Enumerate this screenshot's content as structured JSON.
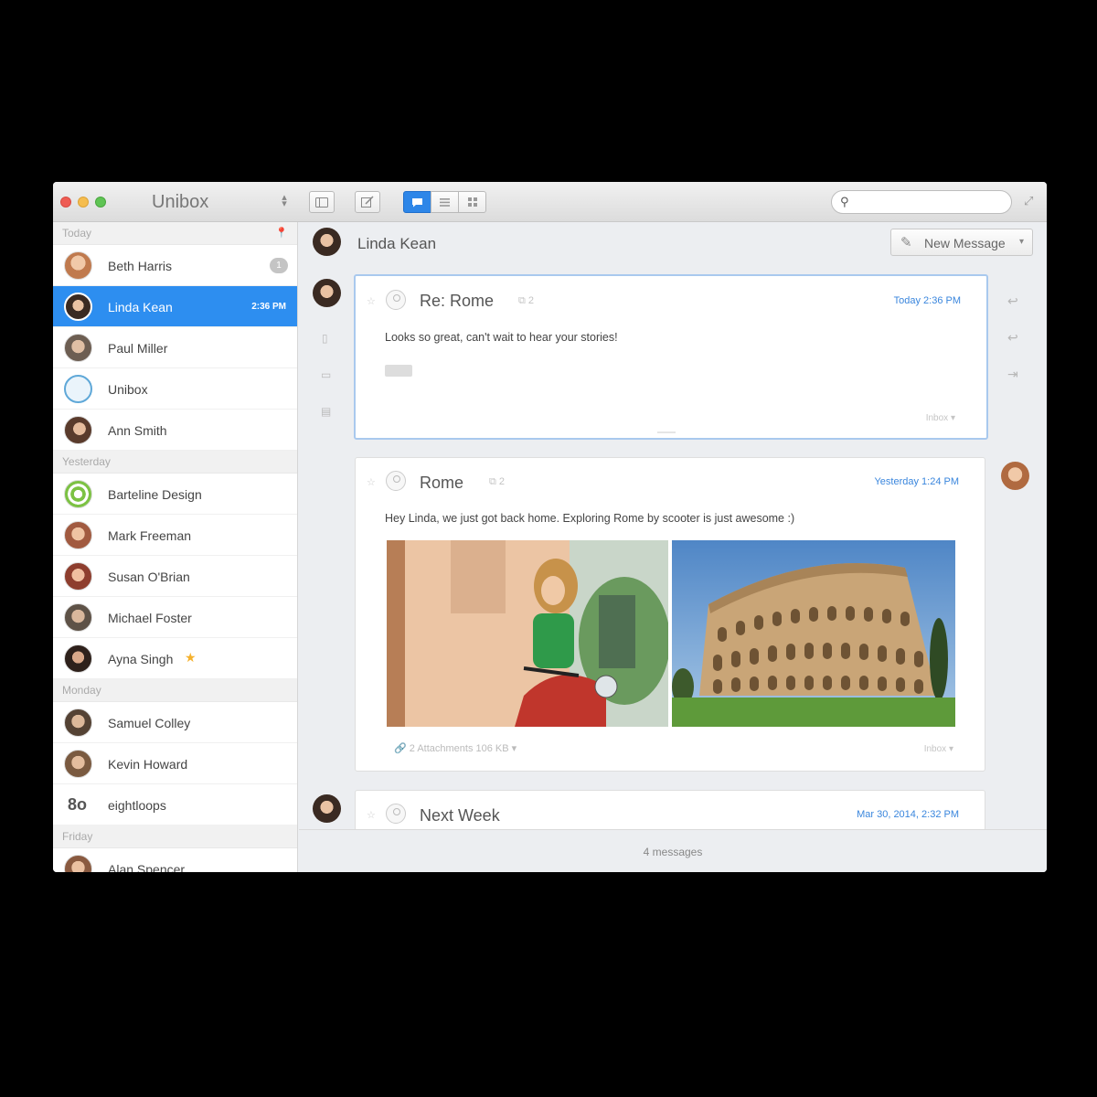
{
  "window": {
    "title": "Unibox"
  },
  "search": {
    "placeholder": "",
    "value": ""
  },
  "sidebar": {
    "sections": [
      {
        "label": "Today",
        "contacts": [
          {
            "name": "Beth Harris",
            "badge": "1",
            "avatar_color": "#c98a6c"
          },
          {
            "name": "Linda Kean",
            "time": "2:36 PM",
            "selected": true,
            "avatar_color": "#4a3a30"
          },
          {
            "name": "Paul Miller",
            "avatar_color": "#8a7a6a"
          },
          {
            "name": "Unibox",
            "avatar_color": "#5fa8d8"
          },
          {
            "name": "Ann Smith",
            "avatar_color": "#6b4a3a"
          }
        ]
      },
      {
        "label": "Yesterday",
        "contacts": [
          {
            "name": "Barteline Design",
            "avatar_color": "#7cc243"
          },
          {
            "name": "Mark Freeman",
            "avatar_color": "#b46a52"
          },
          {
            "name": "Susan O'Brian",
            "avatar_color": "#9a4a3a"
          },
          {
            "name": "Michael Foster",
            "avatar_color": "#7a6a5a"
          },
          {
            "name": "Ayna Singh",
            "starred": true,
            "avatar_color": "#3a2a22"
          }
        ]
      },
      {
        "label": "Monday",
        "contacts": [
          {
            "name": "Samuel Colley",
            "avatar_color": "#6a5848"
          },
          {
            "name": "Kevin Howard",
            "avatar_color": "#8c6a4e"
          },
          {
            "name": "eightloops",
            "logo": "8o"
          }
        ]
      },
      {
        "label": "Friday",
        "contacts": [
          {
            "name": "Alan Spencer",
            "avatar_color": "#a06a50"
          }
        ]
      }
    ]
  },
  "conversation": {
    "name": "Linda Kean",
    "new_message_label": "New Message",
    "messages": [
      {
        "subject": "Re: Rome",
        "thread_count": "2",
        "date": "Today 2:36 PM",
        "body": "Looks so great, can't wait to hear your stories!",
        "folder": "Inbox"
      },
      {
        "subject": "Rome",
        "thread_count": "2",
        "date": "Yesterday 1:24 PM",
        "body": "Hey Linda, we just got back home. Exploring Rome by scooter is just awesome :)",
        "attachments": "2 Attachments 106 KB",
        "folder": "Inbox"
      },
      {
        "subject": "Next Week",
        "date": "Mar 30, 2014, 2:32 PM"
      }
    ],
    "footer_count": "4 messages"
  },
  "colors": {
    "accent": "#2d8ef0",
    "date_link": "#3a86dd"
  }
}
